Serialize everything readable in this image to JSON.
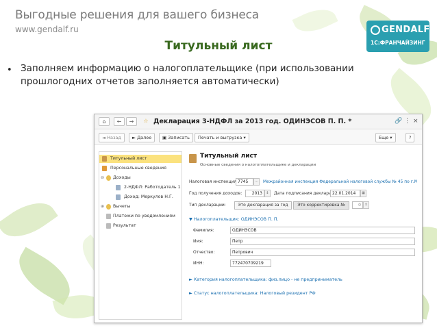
{
  "brand": {
    "tagline": "Выгодные решения для вашего бизнеса",
    "url": "www.gendalf.ru",
    "logo_name": "GENDALF",
    "logo_sub": "1С:ФРАНЧАЙЗИНГ"
  },
  "slide": {
    "title": "Титульный лист",
    "bullet_glyph": "•",
    "bullet_text": "Заполняем информацию о налогоплательщике (при использовании прошлогодних отчетов заполняется автоматически)"
  },
  "window": {
    "title": "Декларация 3-НДФЛ за 2013 год. ОДИНЭСОВ П. П. *",
    "toolbar": {
      "back": "Назад",
      "next": "Далее",
      "save": "Записать",
      "print": "Печать и выгрузка",
      "more": "Еще",
      "help": "?"
    },
    "sidebar": [
      {
        "label": "Титульный лист",
        "selected": true
      },
      {
        "label": "Персональные сведения",
        "selected": false
      },
      {
        "label": "Доходы",
        "selected": false
      },
      {
        "label": "2-НДФЛ: Работодатель 1",
        "selected": false
      },
      {
        "label": "Доход: Меркулов Н.Г.",
        "selected": false
      },
      {
        "label": "Вычеты",
        "selected": false
      },
      {
        "label": "Платежи по уведомлениям",
        "selected": false
      },
      {
        "label": "Результат",
        "selected": false
      }
    ],
    "content": {
      "title": "Титульный лист",
      "subtitle": "Основные сведения о налогоплательщике и декларации",
      "inspection_label": "Налоговая инспекция:",
      "inspection_code": "7745",
      "inspection_name": "Межрайонная инспекция Федеральной налоговой службы № 45 по г.Москв...",
      "year_label": "Год получения доходов:",
      "year_value": "2013",
      "sign_date_label": "Дата подписания декларации:",
      "sign_date_value": "22.01.2014",
      "decl_type_label": "Тип декларации:",
      "decl_type_primary": "Это декларация за год",
      "decl_type_corr": "Это корректировка №",
      "corr_number": "0",
      "taxpayer_group": "▼ Налогоплательщик: ОДИНЭСОВ П. П.",
      "surname_label": "Фамилия:",
      "surname_value": "ОДИНЭСОВ",
      "name_label": "Имя:",
      "name_value": "Петр",
      "patronymic_label": "Отчество:",
      "patronymic_value": "Петрович",
      "inn_label": "ИНН:",
      "inn_value": "772470709219",
      "category_link": "► Категория налогоплательщика: физ.лицо - не предприниматель",
      "status_link": "► Статус налогоплательщика: Налоговый резидент РФ"
    }
  },
  "colors": {
    "title_green": "#3a6a20",
    "logo_teal": "#2a9fb0",
    "selected_yellow": "#fbe27e",
    "link_blue": "#1a6fb0"
  }
}
